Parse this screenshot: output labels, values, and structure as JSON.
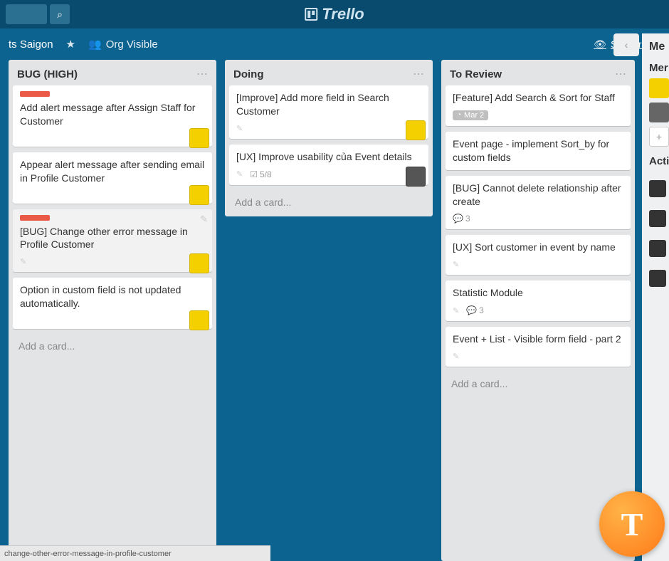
{
  "brand": "Trello",
  "board": {
    "name_suffix": "ts Saigon",
    "visibility": "Org Visible",
    "subscribed_label": "Subscribed"
  },
  "side": {
    "title_cut": "Me",
    "members_cut": "Mer",
    "activity_cut": "Acti"
  },
  "lists": [
    {
      "title": "",
      "cards": [
        {
          "title": ""
        },
        {
          "title": ""
        },
        {
          "title": ""
        },
        {
          "title": ""
        },
        {
          "title": ""
        },
        {
          "title": ""
        }
      ],
      "add": ""
    },
    {
      "title": "BUG (HIGH)",
      "cards": [
        {
          "title": "Add alert message after Assign Staff for Customer",
          "red": true,
          "avatar": "yellow"
        },
        {
          "title": "Appear alert message after sending email in Profile Customer",
          "avatar": "yellow"
        },
        {
          "title": "[BUG] Change other error message in Profile Customer",
          "red": true,
          "avatar": "yellow",
          "pencil": true,
          "hover": true
        },
        {
          "title": "Option in custom field is not updated automatically.",
          "avatar": "yellow"
        }
      ],
      "add": "Add a card..."
    },
    {
      "title": "Doing",
      "cards": [
        {
          "title": "[Improve] Add more field in Search Customer",
          "pencil": true,
          "avatar": "yellow"
        },
        {
          "title": "[UX] Improve usability của Event details",
          "pencil": true,
          "checklist": "5/8",
          "avatar": "gray"
        }
      ],
      "add": "Add a card..."
    },
    {
      "title": "To Review",
      "cards": [
        {
          "title": "[Feature] Add Search & Sort for Staff",
          "due": "Mar 2"
        },
        {
          "title": "Event page - implement Sort_by for custom fields"
        },
        {
          "title": "[BUG] Cannot delete relationship after create",
          "comments": "3"
        },
        {
          "title": "[UX] Sort customer in event by name",
          "pencil": true
        },
        {
          "title": "Statistic Module",
          "pencil": true,
          "comments": "3"
        },
        {
          "title": "Event + List - Visible form field - part 2",
          "pencil": true
        }
      ],
      "add": "Add a card..."
    }
  ],
  "footer_text": "change-other-error-message-in-profile-customer"
}
